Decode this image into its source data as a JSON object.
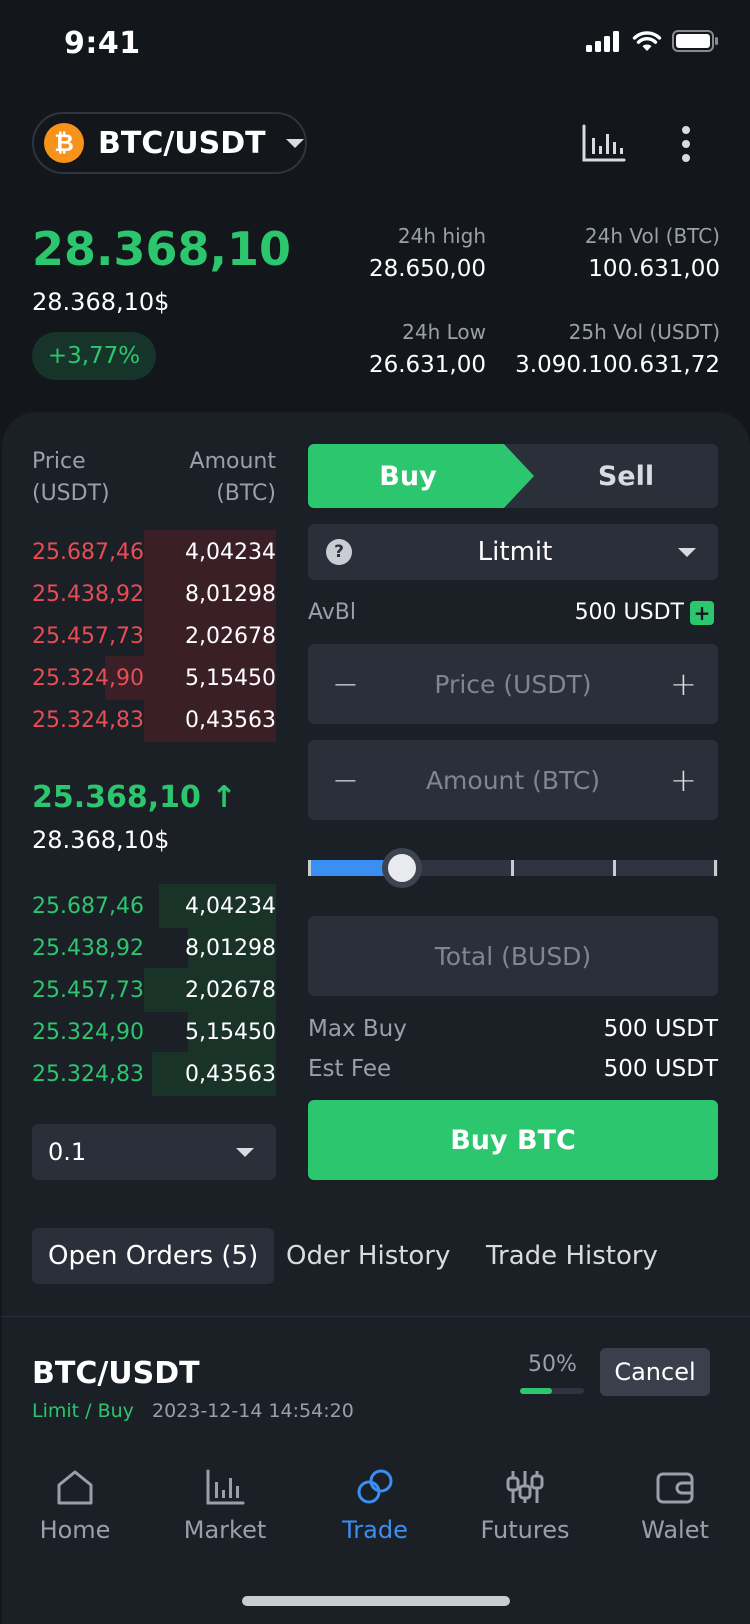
{
  "status_bar": {
    "time": "9:41"
  },
  "header": {
    "coin_symbol": "₿",
    "pair": "BTC/USDT",
    "chart_icon": "chart-bars-icon",
    "more_icon": "more-vertical-icon"
  },
  "ticker": {
    "last_price": "28.368,10",
    "last_price_usd": "28.368,10$",
    "change": "+3,77%",
    "high_label": "24h high",
    "high_value": "28.650,00",
    "vol_btc_label": "24h Vol (BTC)",
    "vol_btc_value": "100.631,00",
    "low_label": "24h Low",
    "low_value": "26.631,00",
    "vol_usdt_label": "25h Vol (USDT)",
    "vol_usdt_value": "3.090.100.631,72"
  },
  "orderbook": {
    "price_header": "Price\n(USDT)",
    "price_header_l1": "Price",
    "price_header_l2": "(USDT)",
    "amount_header_l1": "Amount",
    "amount_header_l2": "(BTC)",
    "asks": [
      {
        "price": "25.687,46",
        "amount": "4,04234",
        "depth": 0.54
      },
      {
        "price": "25.438,92",
        "amount": "8,01298",
        "depth": 0.54
      },
      {
        "price": "25.457,73",
        "amount": "2,02678",
        "depth": 0.54
      },
      {
        "price": "25.324,90",
        "amount": "5,15450",
        "depth": 0.7
      },
      {
        "price": "25.324,83",
        "amount": "0,43563",
        "depth": 0.54
      }
    ],
    "mid_price": "25.368,10 ↑",
    "mid_usd": "28.368,10$",
    "bids": [
      {
        "price": "25.687,46",
        "amount": "4,04234",
        "depth": 0.48
      },
      {
        "price": "25.438,92",
        "amount": "8,01298",
        "depth": 0.36
      },
      {
        "price": "25.457,73",
        "amount": "2,02678",
        "depth": 0.54
      },
      {
        "price": "25.324,90",
        "amount": "5,15450",
        "depth": 0.36
      },
      {
        "price": "25.324,83",
        "amount": "0,43563",
        "depth": 0.51
      }
    ],
    "depth_value": "0.1"
  },
  "trade_form": {
    "buy_label": "Buy",
    "sell_label": "Sell",
    "order_type": "Litmit",
    "avbl_label": "AvBl",
    "avbl_value": "500 USDT",
    "price_placeholder": "Price (USDT)",
    "amount_placeholder": "Amount (BTC)",
    "slider_fraction": 0.23,
    "total_placeholder": "Total (BUSD)",
    "max_buy_label": "Max Buy",
    "max_buy_value": "500 USDT",
    "est_fee_label": "Est Fee",
    "est_fee_value": "500 USDT",
    "submit_label": "Buy BTC"
  },
  "order_tabs": {
    "open": "Open Orders (5)",
    "history": "Oder History",
    "trades": "Trade History"
  },
  "open_order": {
    "pair": "BTC/USDT",
    "type": "Limit / Buy",
    "time": "2023-12-14 14:54:20",
    "filled": "50%",
    "filled_fraction": 0.5,
    "cancel_label": "Cancel"
  },
  "nav": [
    {
      "label": "Home",
      "icon": "home-icon"
    },
    {
      "label": "Market",
      "icon": "chart-bars-icon"
    },
    {
      "label": "Trade",
      "icon": "trade-icon"
    },
    {
      "label": "Futures",
      "icon": "sliders-icon"
    },
    {
      "label": "Walet",
      "icon": "wallet-icon"
    }
  ],
  "colors": {
    "background": "#13161b",
    "panel": "#1b1f26",
    "green": "#2cc66e",
    "red": "#e84d55",
    "blue": "#3a8ff2",
    "bitcoin": "#f7931a"
  }
}
